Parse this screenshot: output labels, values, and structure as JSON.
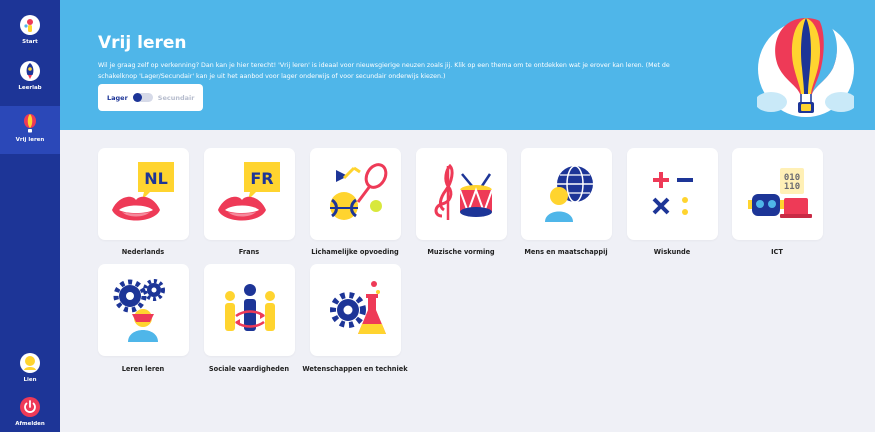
{
  "sidebar": {
    "start": "Start",
    "leerlab": "Leerlab",
    "vrij_leren": "Vrij leren",
    "user": "Lien",
    "logout": "Afmelden"
  },
  "header": {
    "title": "Vrij leren",
    "intro": "Wil je graag zelf op verkenning? Dan kan je hier terecht! 'Vrij leren' is ideaal voor nieuwsgierige neuzen zoals jij. Klik op een thema om te ontdekken wat je erover kan leren. (Met de schakelknop 'Lager/Secundair' kan je uit het aanbod voor lager onderwijs of voor secundair onderwijs kiezen.)",
    "toggle_left": "Lager",
    "toggle_right": "Secundair"
  },
  "themes": [
    {
      "label": "Nederlands",
      "icon": "mouth-nl-icon",
      "badge": "NL"
    },
    {
      "label": "Frans",
      "icon": "mouth-fr-icon",
      "badge": "FR"
    },
    {
      "label": "Lichamelijke opvoeding",
      "icon": "sports-icon"
    },
    {
      "label": "Muzische vorming",
      "icon": "music-icon"
    },
    {
      "label": "Mens en maatschappij",
      "icon": "globe-person-icon"
    },
    {
      "label": "Wiskunde",
      "icon": "math-icon"
    },
    {
      "label": "ICT",
      "icon": "robot-icon",
      "binary_1": "010",
      "binary_2": "110"
    },
    {
      "label": "Leren leren",
      "icon": "gears-head-icon"
    },
    {
      "label": "Sociale vaardigheden",
      "icon": "people-icon"
    },
    {
      "label": "Wetenschappen en techniek",
      "icon": "science-icon"
    }
  ],
  "colors": {
    "sidebar": "#1d3597",
    "banner": "#4fb6e9",
    "background": "#eff0f6",
    "accent_yellow": "#ffd42f",
    "accent_red": "#ee3a57"
  }
}
